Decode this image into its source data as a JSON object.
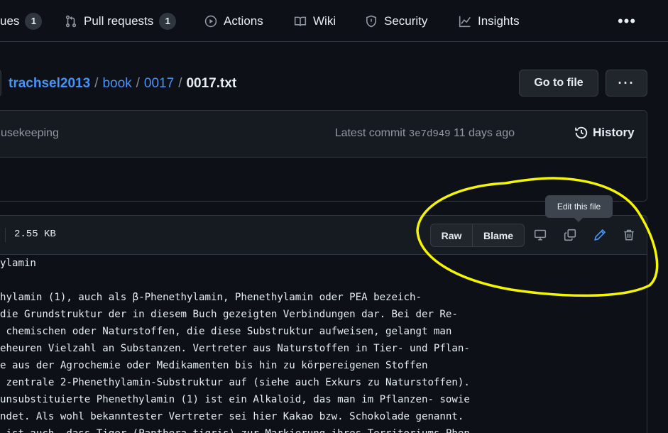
{
  "nav": {
    "issues_label": "ues",
    "issues_count": "1",
    "pulls_label": "Pull requests",
    "pulls_count": "1",
    "actions_label": "Actions",
    "wiki_label": "Wiki",
    "security_label": "Security",
    "insights_label": "Insights",
    "more_label": "•••"
  },
  "breadcrumb": {
    "owner": "trachsel2013",
    "repo": "book",
    "folder": "0017",
    "file": "0017.txt",
    "sep": "/"
  },
  "toolbar": {
    "goto_label": "Go to file",
    "kebab_label": "···"
  },
  "commit": {
    "message": "usekeeping",
    "meta_prefix": "Latest commit",
    "sha": "3e7d949",
    "age": "11 days ago",
    "history_label": "History"
  },
  "file": {
    "size": "2.55 KB",
    "raw_label": "Raw",
    "blame_label": "Blame",
    "tooltip": "Edit this file",
    "lines": [
      "ylamin",
      "",
      "hylamin (1), auch als β-Phenethylamin, Phenethylamin oder PEA bezeich-",
      "die Grundstruktur der in diesem Buch gezeigten Verbindungen dar. Bei der Re-",
      " chemischen oder Naturstoffen, die diese Substruktur aufweisen, gelangt man",
      "eheuren Vielzahl an Substanzen. Vertreter aus Naturstoffen in Tier- und Pflan-",
      "e aus der Agrochemie oder Medikamenten bis hin zu körpereigenen Stoffen",
      " zentrale 2-Phenethylamin-Substruktur auf (siehe auch Exkurs zu Naturstoffen).",
      "unsubstituierte Phenethylamin (1) ist ein Alkaloid, das man im Pflanzen- sowie",
      "ndet. Als wohl bekanntester Vertreter sei hier Kakao bzw. Schokolade genannt.",
      " ist auch, dass Tiger (Panthera tigris) zur Markierung ihres Territoriums Phen-"
    ]
  },
  "colors": {
    "background": "#0d1117",
    "accent_link": "#4493f8",
    "annotation": "#f5f500"
  }
}
